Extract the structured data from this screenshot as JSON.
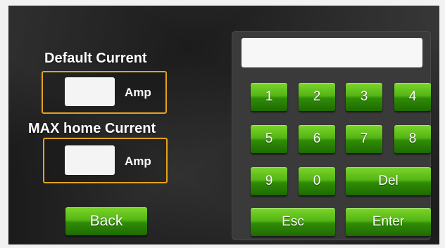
{
  "default_current": {
    "label": "Default Current",
    "value": "",
    "unit": "Amp"
  },
  "max_home_current": {
    "label": "MAX home Current",
    "value": "",
    "unit": "Amp"
  },
  "back_label": "Back",
  "keypad": {
    "display_value": "",
    "keys": {
      "k1": "1",
      "k2": "2",
      "k3": "3",
      "k4": "4",
      "k5": "5",
      "k6": "6",
      "k7": "7",
      "k8": "8",
      "k9": "9",
      "k0": "0",
      "del": "Del",
      "esc": "Esc",
      "enter": "Enter"
    }
  },
  "colors": {
    "accent_border": "#e6a21c",
    "button_green": "#4caf18"
  }
}
